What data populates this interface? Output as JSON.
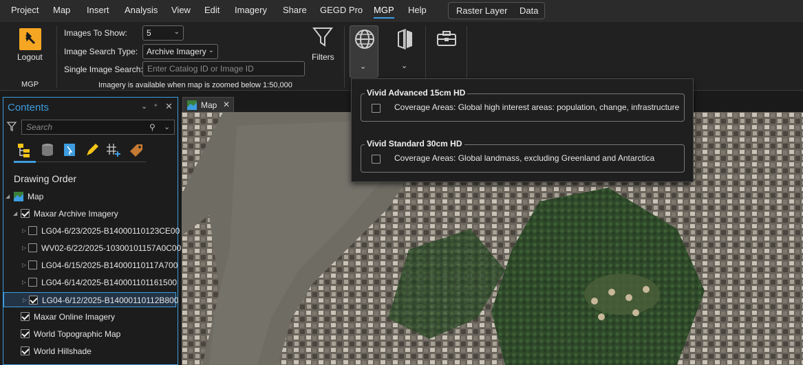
{
  "menubar": {
    "items": [
      "Project",
      "Map",
      "Insert",
      "Analysis",
      "View",
      "Edit",
      "Imagery",
      "Share",
      "GEGD Pro",
      "MGP",
      "Help"
    ],
    "active": "MGP",
    "context_tabs": [
      "Raster Layer",
      "Data"
    ]
  },
  "ribbon": {
    "logout_label": "Logout",
    "group_mgp": "MGP",
    "images_to_show_label": "Images To Show:",
    "images_to_show_value": "5",
    "image_search_type_label": "Image Search Type:",
    "image_search_type_value": "Archive Imagery",
    "single_image_search_label": "Single Image Search:",
    "single_image_search_placeholder": "Enter Catalog ID or Image ID",
    "zoom_note": "Imagery is available when map is zoomed below 1:50,000",
    "filters_label": "Filters"
  },
  "dropdown": {
    "options": [
      {
        "title": "Vivid Advanced 15cm HD",
        "description": "Coverage Areas: Global high interest areas: population, change, infrastructure",
        "checked": false
      },
      {
        "title": "Vivid Standard 30cm HD",
        "description": "Coverage Areas: Global landmass, excluding Greenland and Antarctica",
        "checked": false
      }
    ]
  },
  "contents": {
    "title": "Contents",
    "search_placeholder": "Search",
    "drawing_order": "Drawing Order",
    "map_node": "Map",
    "archive_group": "Maxar Archive Imagery",
    "archive_layers": [
      {
        "name": "LG04-6/23/2025-B14000110123CE00",
        "checked": false,
        "selected": false
      },
      {
        "name": "WV02-6/22/2025-10300101157A0C00",
        "checked": false,
        "selected": false
      },
      {
        "name": "LG04-6/15/2025-B14000110117A700",
        "checked": false,
        "selected": false
      },
      {
        "name": "LG04-6/14/2025-B140001101161500",
        "checked": false,
        "selected": false
      },
      {
        "name": "LG04-6/12/2025-B14000110112B800",
        "checked": true,
        "selected": true
      }
    ],
    "other_layers": [
      {
        "name": "Maxar Online Imagery",
        "checked": true
      },
      {
        "name": "World Topographic Map",
        "checked": true
      },
      {
        "name": "World Hillshade",
        "checked": true
      }
    ]
  },
  "map": {
    "tab_label": "Map"
  }
}
